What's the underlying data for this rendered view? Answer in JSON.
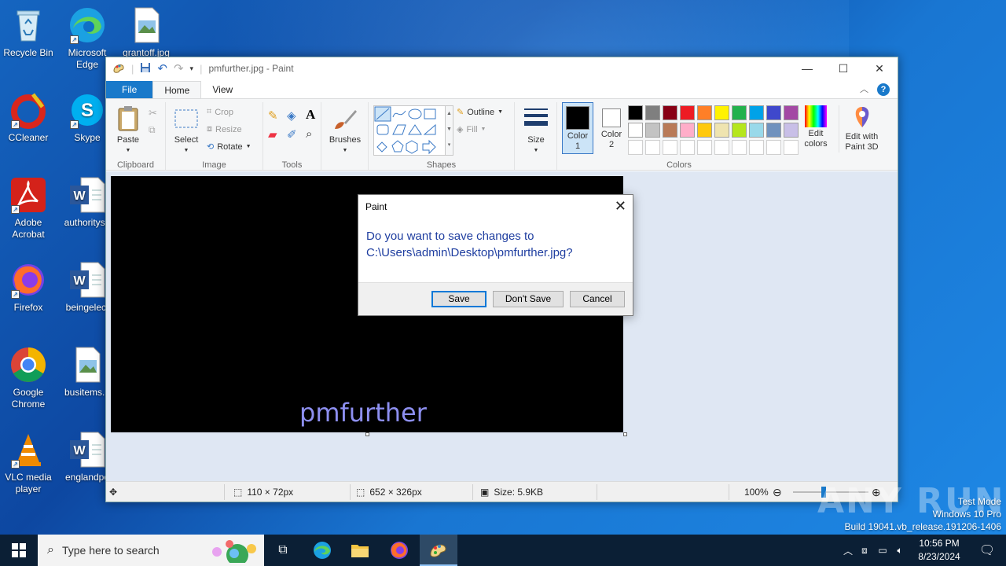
{
  "desktop": {
    "icons": [
      {
        "label": "Recycle Bin"
      },
      {
        "label": "Microsoft Edge"
      },
      {
        "label": "grantoff.jpg"
      },
      {
        "label": "CCleaner"
      },
      {
        "label": "Skype"
      },
      {
        "label": "Adobe Acrobat"
      },
      {
        "label": "authoritysa"
      },
      {
        "label": "Firefox"
      },
      {
        "label": "beingelect"
      },
      {
        "label": "Google Chrome"
      },
      {
        "label": "busitems..."
      },
      {
        "label": "VLC media player"
      },
      {
        "label": "englandpo"
      }
    ],
    "watermark": {
      "line1": "Test Mode",
      "line2": "Windows 10 Pro",
      "line3": "Build 19041.vb_release.191206-1406"
    },
    "brand": "ANY RUN"
  },
  "paint": {
    "title": "pmfurther.jpg - Paint",
    "tabs": {
      "file": "File",
      "home": "Home",
      "view": "View"
    },
    "ribbon": {
      "clipboard": {
        "paste": "Paste",
        "group": "Clipboard"
      },
      "image": {
        "select": "Select",
        "crop": "Crop",
        "resize": "Resize",
        "rotate": "Rotate",
        "group": "Image"
      },
      "tools": {
        "group": "Tools"
      },
      "brushes": {
        "label": "Brushes"
      },
      "shapes": {
        "outline": "Outline",
        "fill": "Fill",
        "group": "Shapes"
      },
      "size": {
        "label": "Size"
      },
      "colors": {
        "color1": "Color 1",
        "color2": "Color 2",
        "group": "Colors",
        "edit": "Edit colors",
        "paint3d": "Edit with Paint 3D",
        "palette_row1": [
          "#000000",
          "#7f7f7f",
          "#880015",
          "#ed1c24",
          "#ff7f27",
          "#fff200",
          "#22b14c",
          "#00a2e8",
          "#3f48cc",
          "#a349a4"
        ],
        "palette_row2": [
          "#ffffff",
          "#c3c3c3",
          "#b97a57",
          "#ffaec9",
          "#ffc90e",
          "#efe4b0",
          "#b5e61d",
          "#99d9ea",
          "#7092be",
          "#c8bfe7"
        ]
      }
    },
    "canvas": {
      "text": "pmfurther"
    },
    "status": {
      "selection": "110 × 72px",
      "image_size": "652 × 326px",
      "file_size": "Size: 5.9KB",
      "zoom": "100%"
    }
  },
  "dialog": {
    "title": "Paint",
    "message_line1": "Do you want to save changes to",
    "message_line2": "C:\\Users\\admin\\Desktop\\pmfurther.jpg?",
    "save": "Save",
    "dont_save": "Don't Save",
    "cancel": "Cancel"
  },
  "taskbar": {
    "search_placeholder": "Type here to search",
    "time": "10:56 PM",
    "date": "8/23/2024"
  }
}
